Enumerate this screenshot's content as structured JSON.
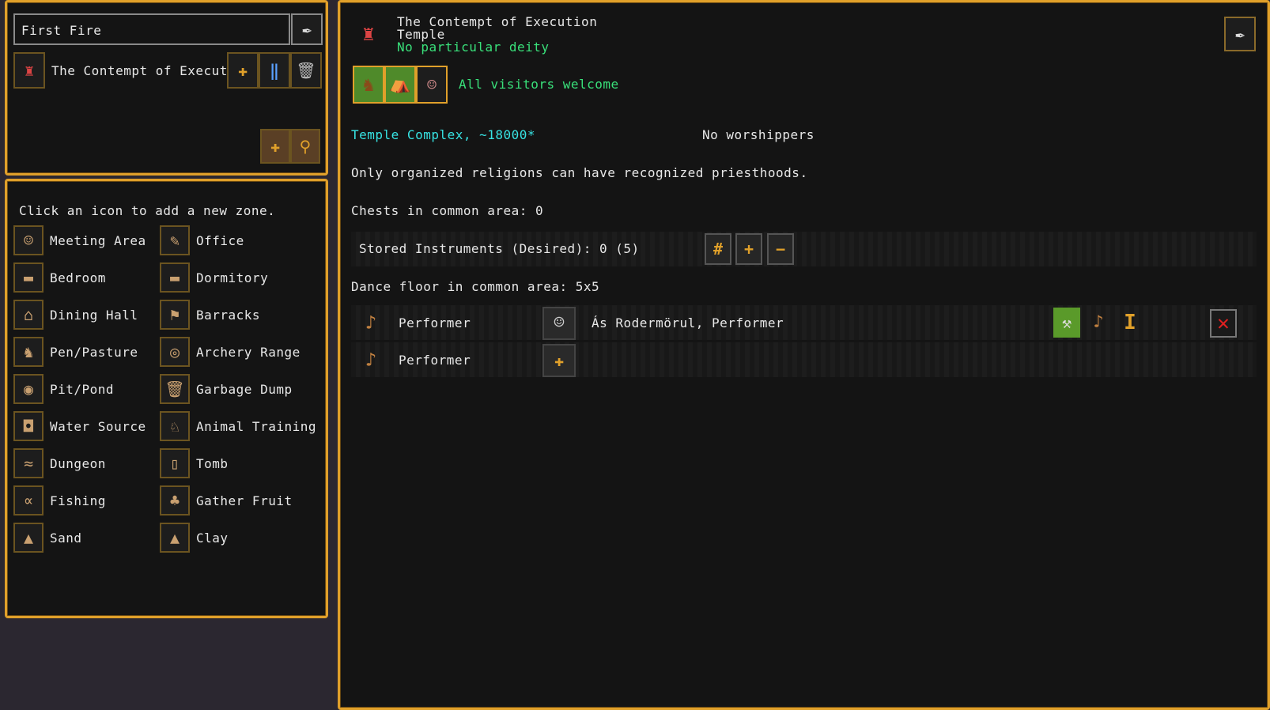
{
  "location": {
    "name_value": "First Fire",
    "zone_name": "The Contempt of Execution"
  },
  "add_zone": {
    "prompt": "Click an icon to add a new zone.",
    "zones_left": [
      {
        "label": "Meeting Area",
        "icon": "meeting-area-icon",
        "glyph": "☺"
      },
      {
        "label": "Bedroom",
        "icon": "bedroom-icon",
        "glyph": "▬"
      },
      {
        "label": "Dining Hall",
        "icon": "dining-hall-icon",
        "glyph": "⌂"
      },
      {
        "label": "Pen/Pasture",
        "icon": "pen-pasture-icon",
        "glyph": "♞"
      },
      {
        "label": "Pit/Pond",
        "icon": "pit-pond-icon",
        "glyph": "◉"
      },
      {
        "label": "Water Source",
        "icon": "water-source-icon",
        "glyph": "◘"
      },
      {
        "label": "Dungeon",
        "icon": "dungeon-icon",
        "glyph": "≈"
      },
      {
        "label": "Fishing",
        "icon": "fishing-icon",
        "glyph": "∝"
      },
      {
        "label": "Sand",
        "icon": "sand-icon",
        "glyph": "▲"
      }
    ],
    "zones_right": [
      {
        "label": "Office",
        "icon": "office-icon",
        "glyph": "✎"
      },
      {
        "label": "Dormitory",
        "icon": "dormitory-icon",
        "glyph": "▬"
      },
      {
        "label": "Barracks",
        "icon": "barracks-icon",
        "glyph": "⚑"
      },
      {
        "label": "Archery Range",
        "icon": "archery-range-icon",
        "glyph": "◎"
      },
      {
        "label": "Garbage Dump",
        "icon": "garbage-dump-icon",
        "glyph": "🗑"
      },
      {
        "label": "Animal Training",
        "icon": "animal-training-icon",
        "glyph": "♘"
      },
      {
        "label": "Tomb",
        "icon": "tomb-icon",
        "glyph": "▯"
      },
      {
        "label": "Gather Fruit",
        "icon": "gather-fruit-icon",
        "glyph": "♣"
      },
      {
        "label": "Clay",
        "icon": "clay-icon",
        "glyph": "▲"
      }
    ]
  },
  "detail": {
    "title": "The Contempt of Execution",
    "type": "Temple",
    "deity": "No particular deity",
    "access": "All visitors welcome",
    "complex": "Temple Complex, ~18000*",
    "worshippers": "No worshippers",
    "priesthood_note": "Only organized religions can have recognized priesthoods.",
    "chests": "Chests in common area: 0",
    "instruments": "Stored Instruments (Desired): 0 (5)",
    "dance_floor": "Dance floor in common area: 5x5",
    "performers": [
      {
        "role": "Performer",
        "assigned": "Ás Rodermörul, Performer"
      },
      {
        "role": "Performer",
        "assigned": ""
      }
    ]
  },
  "colors": {
    "accent": "#e0a02a",
    "cyan": "#37e3e3",
    "green": "#39e07a",
    "panel": "#141414"
  }
}
